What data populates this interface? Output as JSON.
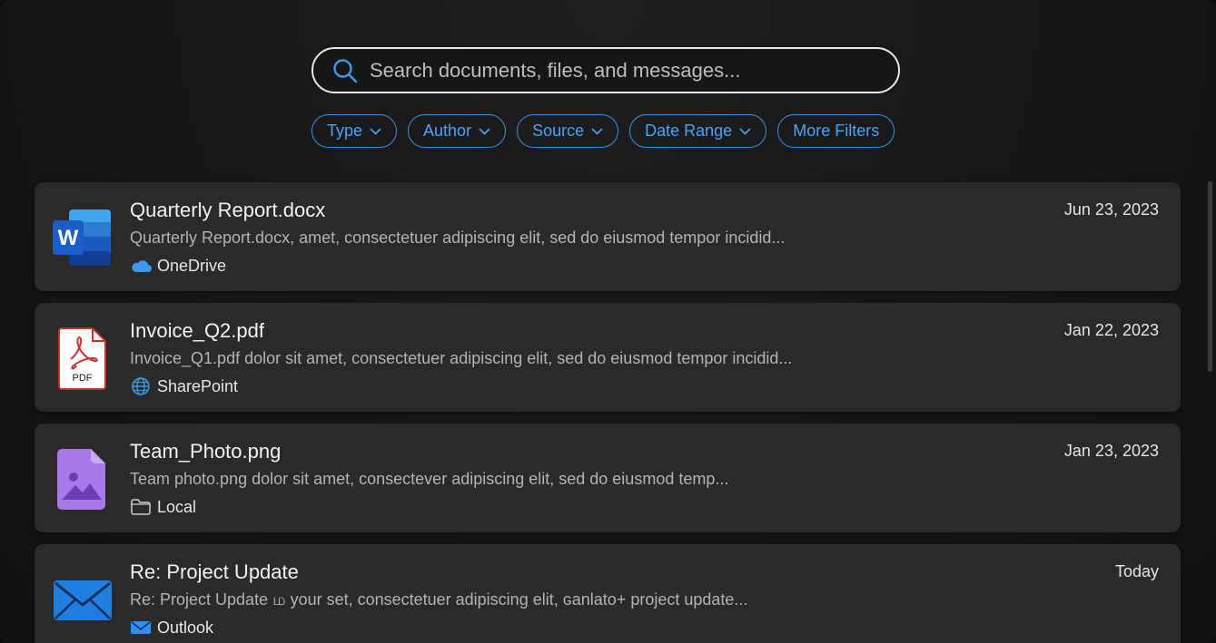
{
  "search": {
    "placeholder": "Search documents, files, and messages..."
  },
  "filters": [
    {
      "label": "Type",
      "has_dropdown": true
    },
    {
      "label": "Author",
      "has_dropdown": true
    },
    {
      "label": "Source",
      "has_dropdown": true
    },
    {
      "label": "Date Range",
      "has_dropdown": true
    },
    {
      "label": "More Filters",
      "has_dropdown": false
    }
  ],
  "results": [
    {
      "title": "Quarterly Report.docx",
      "snippet": "Quarterly Report.docx, amet, consectetuer adipiscing elit, sed do eiusmod tempor incidid...",
      "source": "OneDrive",
      "date": "Jun 23, 2023",
      "file_icon": "word-icon",
      "source_icon": "onedrive-cloud-icon"
    },
    {
      "title": "Invoice_Q2.pdf",
      "snippet": "Invoice_Q1.pdf dolor sit amet, consectetuer adipiscing elit, sed do eiusmod tempor incidid...",
      "source": "SharePoint",
      "date": "Jan 22, 2023",
      "file_icon": "pdf-icon",
      "file_icon_label": "PDF",
      "source_icon": "globe-icon"
    },
    {
      "title": "Team_Photo.png",
      "snippet": "Team photo.png dolor sit amet, consectever adipiscing elit, sed do eiusmod temp...",
      "source": "Local",
      "date": "Jan 23, 2023",
      "file_icon": "image-file-icon",
      "source_icon": "folder-icon"
    },
    {
      "title": "Re: Project Update",
      "snippet": "Re: Project Update ம your set, consectetuer adipiscing elit, ɢanlato+ project update...",
      "source": "Outlook",
      "date": "Today",
      "file_icon": "mail-envelope-icon",
      "source_icon": "outlook-envelope-icon"
    }
  ],
  "colors": {
    "accent": "#3a8fe0",
    "card_bg": "#2a2a2a",
    "window_bg": "#161616"
  }
}
